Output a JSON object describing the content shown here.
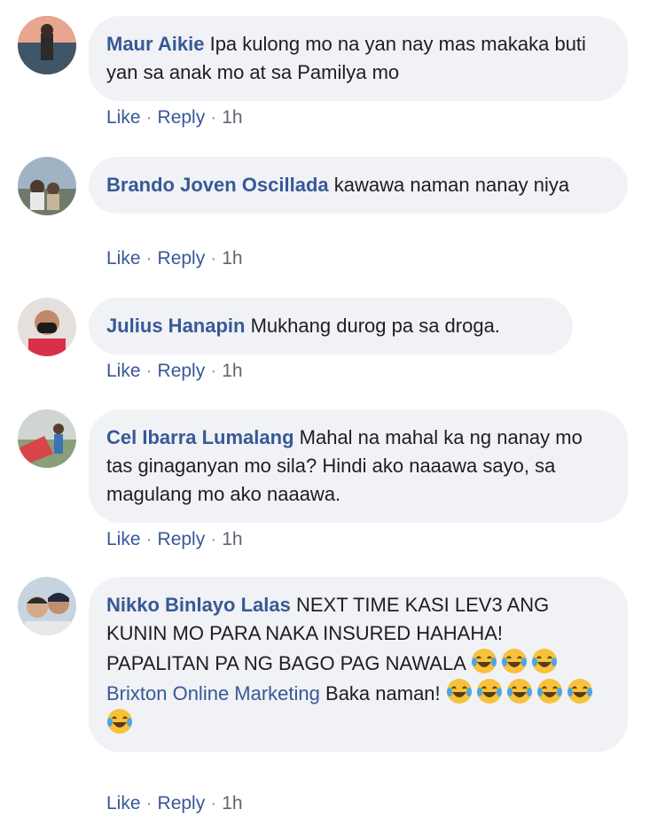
{
  "comments": [
    {
      "author": "Maur Aikie",
      "text": "Ipa kulong mo na yan nay mas makaka buti yan sa anak mo at sa Pamilya mo",
      "like": "Like",
      "reply": "Reply",
      "time": "1h"
    },
    {
      "author": "Brando Joven Oscillada",
      "text": "kawawa naman nanay niya",
      "like": "Like",
      "reply": "Reply",
      "time": "1h"
    },
    {
      "author": "Julius Hanapin",
      "text": "Mukhang durog pa sa droga.",
      "like": "Like",
      "reply": "Reply",
      "time": "1h"
    },
    {
      "author": "Cel Ibarra Lumalang",
      "text": "Mahal na mahal ka ng nanay mo tas ginaganyan mo sila? Hindi ako naaawa sayo, sa magulang mo ako naaawa.",
      "like": "Like",
      "reply": "Reply",
      "time": "1h"
    },
    {
      "author": "Nikko Binlayo Lalas",
      "text": "NEXT TIME KASI LEV3 ANG KUNIN MO PARA NAKA INSURED HAHAHA! PAPALITAN PA NG BAGO PAG NAWALA",
      "emoji_count": 3,
      "reply_author": "Brixton Online Marketing",
      "reply_text": "Baka naman!",
      "reply_emoji_count": 6,
      "like": "Like",
      "reply": "Reply",
      "time": "1h"
    }
  ],
  "icons": {
    "emoji": "laughing-tears-emoji-icon"
  },
  "colors": {
    "bubble": "#f0f2f5",
    "author": "#385898",
    "meta": "#606770"
  }
}
